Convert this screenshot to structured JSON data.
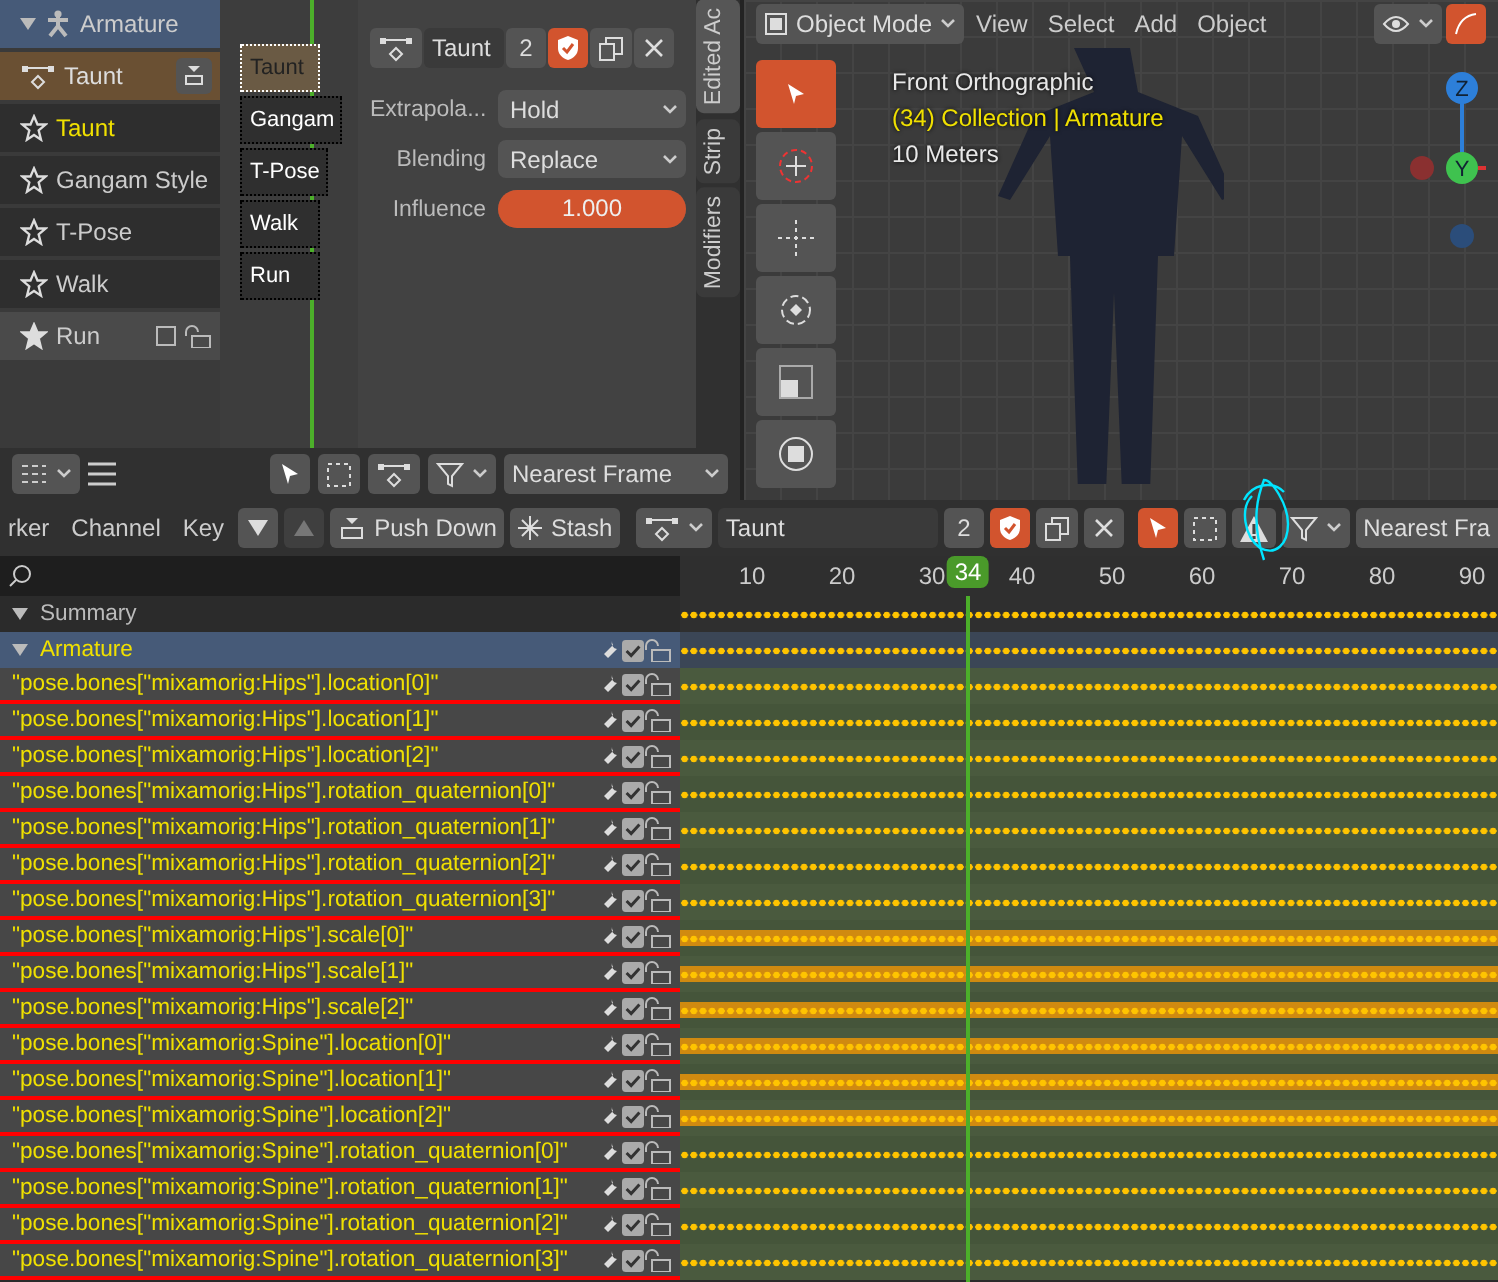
{
  "nla": {
    "object": {
      "name": "Armature",
      "expanded": true
    },
    "action_track": {
      "name": "Taunt"
    },
    "tracks": [
      {
        "name": "Taunt",
        "selected": true,
        "solo": false
      },
      {
        "name": "Gangam Style",
        "selected": false,
        "solo": false
      },
      {
        "name": "T-Pose",
        "selected": false,
        "solo": false
      },
      {
        "name": "Walk",
        "selected": false,
        "solo": false
      },
      {
        "name": "Run",
        "selected": false,
        "solo": true
      }
    ],
    "strips": [
      {
        "label": "Taunt",
        "selected": true
      },
      {
        "label": "Gangam",
        "selected": false
      },
      {
        "label": "T-Pose",
        "selected": false
      },
      {
        "label": "Walk",
        "selected": false
      },
      {
        "label": "Run",
        "selected": false
      }
    ],
    "sidebar": {
      "action": "Taunt",
      "users": "2",
      "fields": [
        {
          "label": "Extrapola...",
          "value": "Hold",
          "kind": "dropdown"
        },
        {
          "label": "Blending",
          "value": "Replace",
          "kind": "dropdown"
        },
        {
          "label": "Influence",
          "value": "1.000",
          "kind": "slider",
          "level": 1
        }
      ]
    },
    "tabs": [
      {
        "label": "Edited Ac",
        "selected": true
      },
      {
        "label": "Strip",
        "selected": false
      },
      {
        "label": "Modifiers",
        "selected": false
      }
    ],
    "snap": "Nearest Frame"
  },
  "viewport": {
    "mode": "Object Mode",
    "menus": [
      "View",
      "Select",
      "Add",
      "Object"
    ],
    "overlay": [
      {
        "text": "Front Orthographic",
        "kind": "view"
      },
      {
        "text": "(34) Collection | Armature",
        "kind": "context"
      },
      {
        "text": "10 Meters",
        "kind": "scale"
      }
    ],
    "axes": [
      "Z",
      "Y"
    ]
  },
  "dopesheet": {
    "menus": [
      "rker",
      "Channel",
      "Key"
    ],
    "buttons": [
      "Push Down",
      "Stash"
    ],
    "action": "Taunt",
    "users": "2",
    "snap": "Nearest Fra",
    "ticks": [
      "10",
      "20",
      "30",
      "40",
      "50",
      "60",
      "70",
      "80",
      "90"
    ],
    "current_frame": "34",
    "summary": {
      "name": "Summary",
      "expanded": true
    },
    "object": {
      "name": "Armature",
      "expanded": true
    },
    "channels": [
      {
        "name": "\"pose.bones[\"mixamorig:Hips\"].location[0]\"",
        "selected": false
      },
      {
        "name": "\"pose.bones[\"mixamorig:Hips\"].location[1]\"",
        "selected": false
      },
      {
        "name": "\"pose.bones[\"mixamorig:Hips\"].location[2]\"",
        "selected": false
      },
      {
        "name": "\"pose.bones[\"mixamorig:Hips\"].rotation_quaternion[0]\"",
        "selected": false
      },
      {
        "name": "\"pose.bones[\"mixamorig:Hips\"].rotation_quaternion[1]\"",
        "selected": false
      },
      {
        "name": "\"pose.bones[\"mixamorig:Hips\"].rotation_quaternion[2]\"",
        "selected": false
      },
      {
        "name": "\"pose.bones[\"mixamorig:Hips\"].rotation_quaternion[3]\"",
        "selected": false
      },
      {
        "name": "\"pose.bones[\"mixamorig:Hips\"].scale[0]\"",
        "selected": true
      },
      {
        "name": "\"pose.bones[\"mixamorig:Hips\"].scale[1]\"",
        "selected": true
      },
      {
        "name": "\"pose.bones[\"mixamorig:Hips\"].scale[2]\"",
        "selected": true
      },
      {
        "name": "\"pose.bones[\"mixamorig:Spine\"].location[0]\"",
        "selected": true
      },
      {
        "name": "\"pose.bones[\"mixamorig:Spine\"].location[1]\"",
        "selected": true
      },
      {
        "name": "\"pose.bones[\"mixamorig:Spine\"].location[2]\"",
        "selected": true
      },
      {
        "name": "\"pose.bones[\"mixamorig:Spine\"].rotation_quaternion[0]\"",
        "selected": false
      },
      {
        "name": "\"pose.bones[\"mixamorig:Spine\"].rotation_quaternion[1]\"",
        "selected": false
      },
      {
        "name": "\"pose.bones[\"mixamorig:Spine\"].rotation_quaternion[2]\"",
        "selected": false
      },
      {
        "name": "\"pose.bones[\"mixamorig:Spine\"].rotation_quaternion[3]\"",
        "selected": false
      }
    ]
  }
}
